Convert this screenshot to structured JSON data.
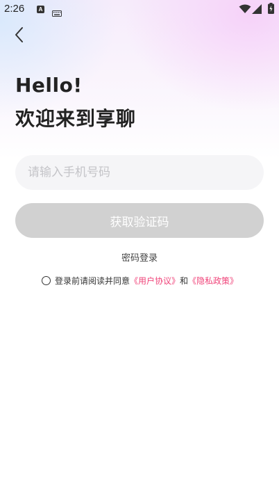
{
  "status_bar": {
    "time": "2:26",
    "a_badge": "A"
  },
  "header": {
    "back_icon": "chevron-left-icon"
  },
  "welcome": {
    "line1": "Hello!",
    "line2": "欢迎来到享聊"
  },
  "form": {
    "phone_placeholder": "请输入手机号码",
    "phone_value": "",
    "get_code_label": "获取验证码",
    "password_login_label": "密码登录"
  },
  "agreement": {
    "checked": false,
    "prefix": "登录前请阅读并同意",
    "user_agreement_link": "《用户协议》",
    "conjunction": "和",
    "privacy_policy_link": "《隐私政策》"
  },
  "colors": {
    "link": "#f0447a",
    "disabled_button": "#d1d1d1",
    "input_bg": "#f5f5f7"
  }
}
